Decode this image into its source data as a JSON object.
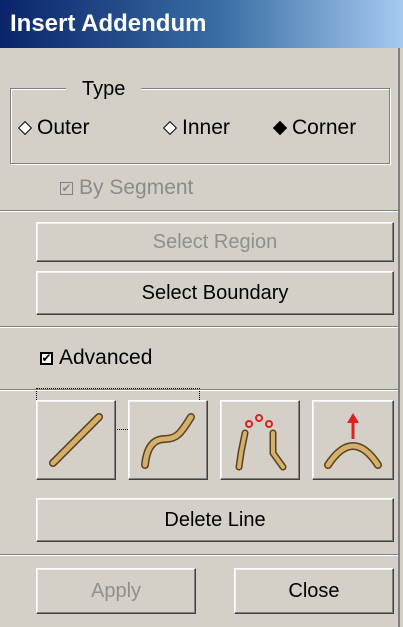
{
  "window": {
    "title": "Insert Addendum"
  },
  "type_group": {
    "label": "Type",
    "options": [
      {
        "label": "Outer",
        "selected": false
      },
      {
        "label": "Inner",
        "selected": false
      },
      {
        "label": "Corner",
        "selected": true
      }
    ]
  },
  "by_segment": {
    "label": "By Segment",
    "checked": true,
    "enabled": false
  },
  "buttons": {
    "select_region": "Select Region",
    "select_boundary": "Select Boundary",
    "delete_line": "Delete Line",
    "apply": "Apply",
    "close": "Close"
  },
  "advanced": {
    "label": "Advanced",
    "checked": true
  },
  "tool_icons": [
    "straight-line-icon",
    "curved-line-icon",
    "connected-points-line-icon",
    "arc-up-arrow-icon"
  ],
  "colors": {
    "accent_red": "#e02020",
    "line_tan": "#d4b06a"
  }
}
